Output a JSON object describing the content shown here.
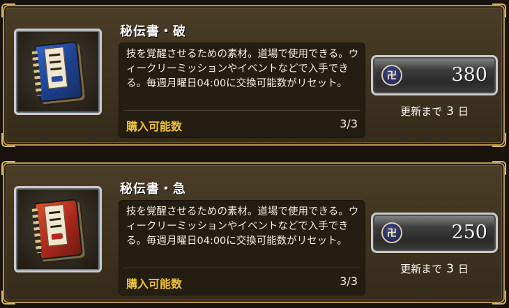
{
  "items": [
    {
      "name": "秘伝書・破",
      "description": "技を覚醒させるための素材。道場で使用できる。ウィークリーミッションやイベントなどで入手できる。毎週月曜日04:00に交換可能数がリセット。",
      "limit_label": "購入可能数",
      "limit_value": "3/3",
      "price": "380",
      "currency_icon": "currency-coin-icon",
      "refresh_prefix": "更新まで",
      "refresh_days": "3",
      "refresh_unit": "日",
      "book_color": "#1f4aa8",
      "book_icon": "scroll-book-blue-icon"
    },
    {
      "name": "秘伝書・急",
      "description": "技を覚醒させるための素材。道場で使用できる。ウィークリーミッションやイベントなどで入手できる。毎週月曜日04:00に交換可能数がリセット。",
      "limit_label": "購入可能数",
      "limit_value": "3/3",
      "price": "250",
      "currency_icon": "currency-coin-icon",
      "refresh_prefix": "更新まで",
      "refresh_days": "3",
      "refresh_unit": "日",
      "book_color": "#b8321f",
      "book_icon": "scroll-book-red-icon"
    }
  ],
  "colors": {
    "accent_gold": "#f0c33b",
    "frame_gold": "#b8934e",
    "panel_brown": "#3d321f"
  }
}
